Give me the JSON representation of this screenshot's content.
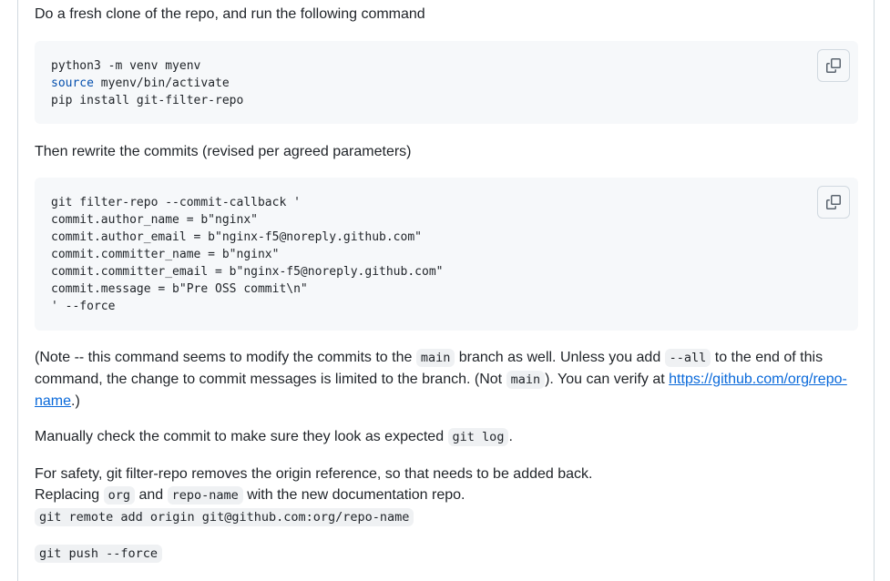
{
  "intro": "Do a fresh clone of the repo, and run the following command",
  "code1": {
    "line1": "python3 -m venv myenv",
    "line2_kw": "source",
    "line2_rest": " myenv/bin/activate",
    "line3": "pip install git-filter-repo"
  },
  "rewrite": "Then rewrite the commits (revised per agreed parameters)",
  "code2": {
    "lines": [
      "git filter-repo --commit-callback '",
      "commit.author_name = b\"nginx\"",
      "commit.author_email = b\"nginx-f5@noreply.github.com\"",
      "commit.committer_name = b\"nginx\"",
      "commit.committer_email = b\"nginx-f5@noreply.github.com\"",
      "commit.message = b\"Pre OSS commit\\n\"",
      "' --force"
    ]
  },
  "note": {
    "t1": "(Note -- this command seems to modify the commits to the ",
    "c1": "main",
    "t2": " branch as well. Unless you add ",
    "c2": "--all",
    "t3": " to the end of this command, the change to commit messages is limited to the branch. (Not ",
    "c3": "main",
    "t4": "). You can verify at ",
    "link": "https://github.com/org/repo-name",
    "t5": ".)"
  },
  "manual": {
    "text": "Manually check the commit to make sure they look as expected ",
    "code": "git log",
    "end": "."
  },
  "safety": {
    "line1": "For safety, git filter-repo removes the origin reference, so that needs to be added back.",
    "r1": "Replacing ",
    "c1": "org",
    "r2": " and ",
    "c2": "repo-name",
    "r3": " with the new documentation repo.",
    "cmd": "git remote add origin git@github.com:org/repo-name"
  },
  "push": "git push --force",
  "colors": {
    "link": "#0969da",
    "keyword": "#0550ae",
    "code_bg": "#f6f8fa"
  }
}
